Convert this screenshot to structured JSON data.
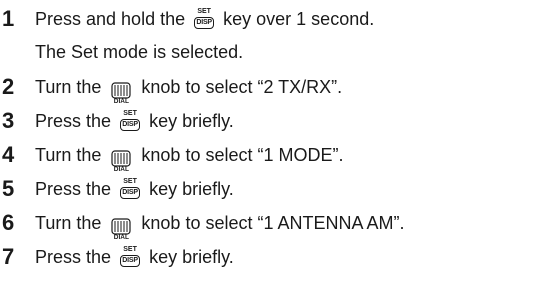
{
  "icons": {
    "set_disp_key": "set-disp-key-icon",
    "dial_knob": "dial-knob-icon"
  },
  "key_label": {
    "set": "SET",
    "disp": "DISP"
  },
  "dial_label": "DIAL",
  "top_fragment": "",
  "steps": [
    {
      "number": "1",
      "pre": "Press and hold the",
      "post": "key over 1 second.",
      "note": "The Set mode is selected."
    },
    {
      "number": "2",
      "pre": "Turn the",
      "post": "knob to select “2 TX/RX”."
    },
    {
      "number": "3",
      "pre": "Press the",
      "post": "key briefly."
    },
    {
      "number": "4",
      "pre": "Turn the",
      "post": "knob to select “1 MODE”."
    },
    {
      "number": "5",
      "pre": "Press the",
      "post": "key briefly."
    },
    {
      "number": "6",
      "pre": "Turn the",
      "post": "knob to select “1 ANTENNA AM”."
    },
    {
      "number": "7",
      "pre": "Press the",
      "post": "key briefly."
    }
  ]
}
